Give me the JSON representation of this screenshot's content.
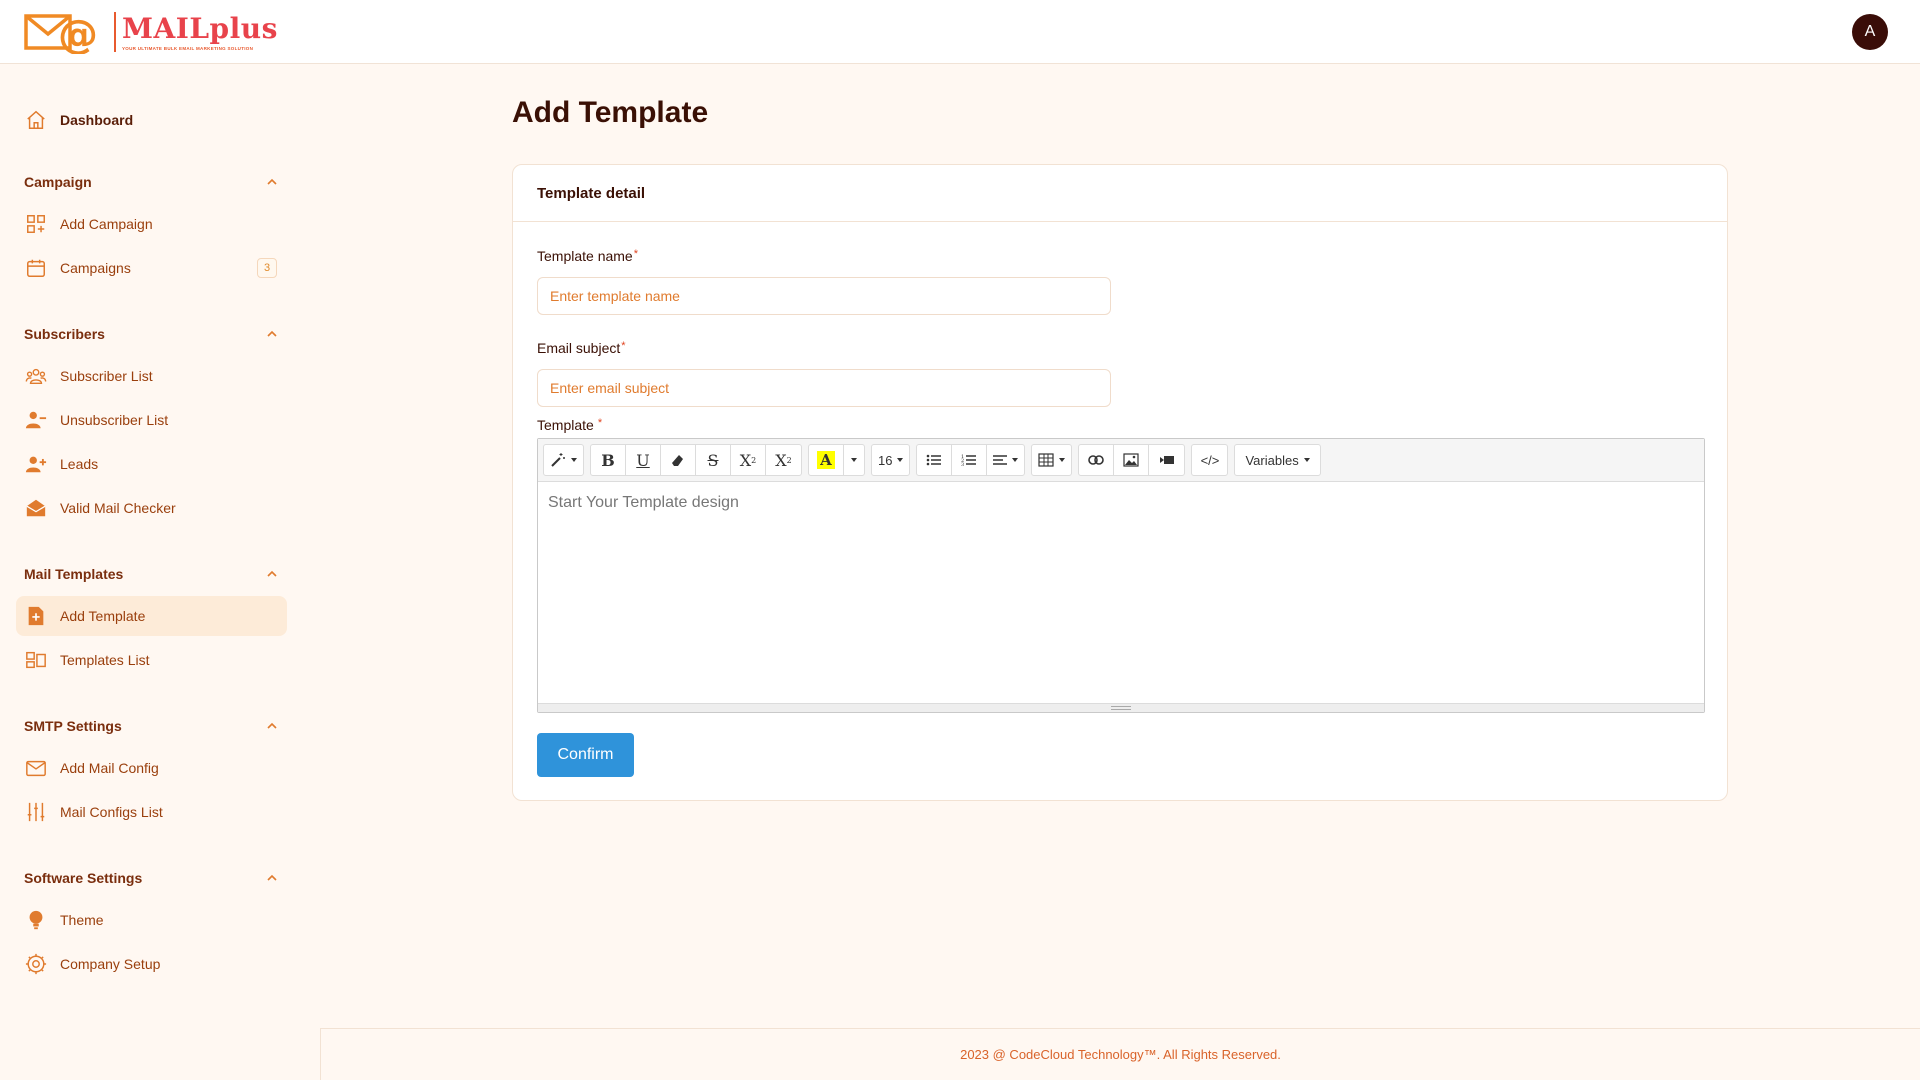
{
  "header": {
    "logo_title": "MAILplus",
    "logo_tagline": "Your Ultimate Bulk Email Marketing Solution",
    "avatar_initial": "A"
  },
  "sidebar": {
    "dashboard": "Dashboard",
    "sections": [
      {
        "title": "Campaign",
        "items": [
          {
            "label": "Add Campaign"
          },
          {
            "label": "Campaigns",
            "badge": "3"
          }
        ]
      },
      {
        "title": "Subscribers",
        "items": [
          {
            "label": "Subscriber List"
          },
          {
            "label": "Unsubscriber List"
          },
          {
            "label": "Leads"
          },
          {
            "label": "Valid Mail Checker"
          }
        ]
      },
      {
        "title": "Mail Templates",
        "items": [
          {
            "label": "Add Template"
          },
          {
            "label": "Templates List"
          }
        ]
      },
      {
        "title": "SMTP Settings",
        "items": [
          {
            "label": "Add Mail Config"
          },
          {
            "label": "Mail Configs List"
          }
        ]
      },
      {
        "title": "Software Settings",
        "items": [
          {
            "label": "Theme"
          },
          {
            "label": "Company Setup"
          }
        ]
      }
    ]
  },
  "main": {
    "page_title": "Add Template",
    "card_title": "Template detail",
    "template_name": {
      "label": "Template name",
      "placeholder": "Enter template name",
      "value": ""
    },
    "email_subject": {
      "label": "Email subject",
      "placeholder": "Enter email subject",
      "value": ""
    },
    "template": {
      "label": "Template",
      "placeholder": "Start Your Template design"
    },
    "toolbar": {
      "font_size": "16",
      "variables_label": "Variables",
      "code_label": "</>"
    },
    "confirm_label": "Confirm"
  },
  "footer": {
    "text": "2023 @ CodeCloud Technology™. All Rights Reserved."
  },
  "colors": {
    "accent": "#e07b2e",
    "primary_button": "#2f93da",
    "background": "#fff8f2",
    "active_item_bg": "#fdebd8"
  }
}
